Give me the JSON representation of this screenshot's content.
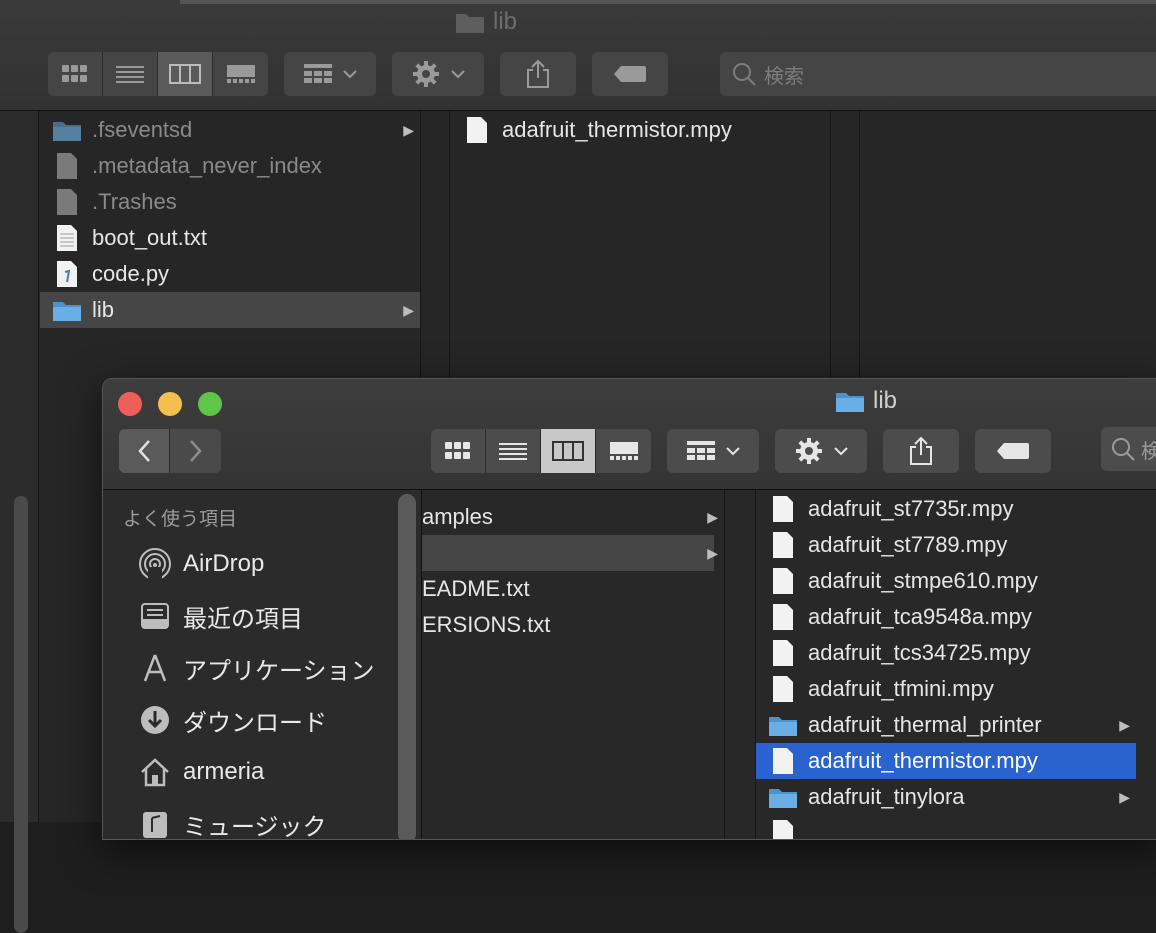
{
  "back_window": {
    "title": "lib",
    "search_placeholder": "検索",
    "column1": [
      {
        "name": ".fseventsd",
        "type": "folder",
        "hidden": true,
        "has_children": true
      },
      {
        "name": ".metadata_never_index",
        "type": "file",
        "hidden": true
      },
      {
        "name": ".Trashes",
        "type": "file",
        "hidden": true
      },
      {
        "name": "boot_out.txt",
        "type": "text"
      },
      {
        "name": "code.py",
        "type": "python"
      },
      {
        "name": "lib",
        "type": "folder",
        "selected": true,
        "has_children": true
      }
    ],
    "column3": [
      {
        "name": "adafruit_thermistor.mpy",
        "type": "file"
      }
    ]
  },
  "front_window": {
    "title": "lib",
    "search_placeholder": "検",
    "sidebar": {
      "heading": "よく使う項目",
      "items": [
        {
          "label": "AirDrop",
          "icon": "airdrop-icon"
        },
        {
          "label": "最近の項目",
          "icon": "recents-icon"
        },
        {
          "label": "アプリケーション",
          "icon": "applications-icon"
        },
        {
          "label": "ダウンロード",
          "icon": "downloads-icon"
        },
        {
          "label": "armeria",
          "icon": "home-icon"
        },
        {
          "label": "ミュージック",
          "icon": "music-icon"
        }
      ]
    },
    "column1": [
      {
        "name": "amples",
        "type": "folder",
        "has_children": true
      },
      {
        "name": "",
        "type": "folder",
        "has_children": true,
        "selected": true
      },
      {
        "name": "EADME.txt",
        "type": "text"
      },
      {
        "name": "ERSIONS.txt",
        "type": "text"
      }
    ],
    "column3": [
      {
        "name": "adafruit_st7735r.mpy",
        "type": "file"
      },
      {
        "name": "adafruit_st7789.mpy",
        "type": "file"
      },
      {
        "name": "adafruit_stmpe610.mpy",
        "type": "file"
      },
      {
        "name": "adafruit_tca9548a.mpy",
        "type": "file"
      },
      {
        "name": "adafruit_tcs34725.mpy",
        "type": "file"
      },
      {
        "name": "adafruit_tfmini.mpy",
        "type": "file"
      },
      {
        "name": "adafruit_thermal_printer",
        "type": "folder",
        "has_children": true
      },
      {
        "name": "adafruit_thermistor.mpy",
        "type": "file",
        "selected": true
      },
      {
        "name": "adafruit_tinylora",
        "type": "folder",
        "has_children": true
      }
    ]
  },
  "colors": {
    "selection_blue": "#2a62d0",
    "folder_blue": "#6aaee6",
    "close": "#ee5f57",
    "minimize": "#f4bf4f",
    "zoom": "#5fc649"
  }
}
